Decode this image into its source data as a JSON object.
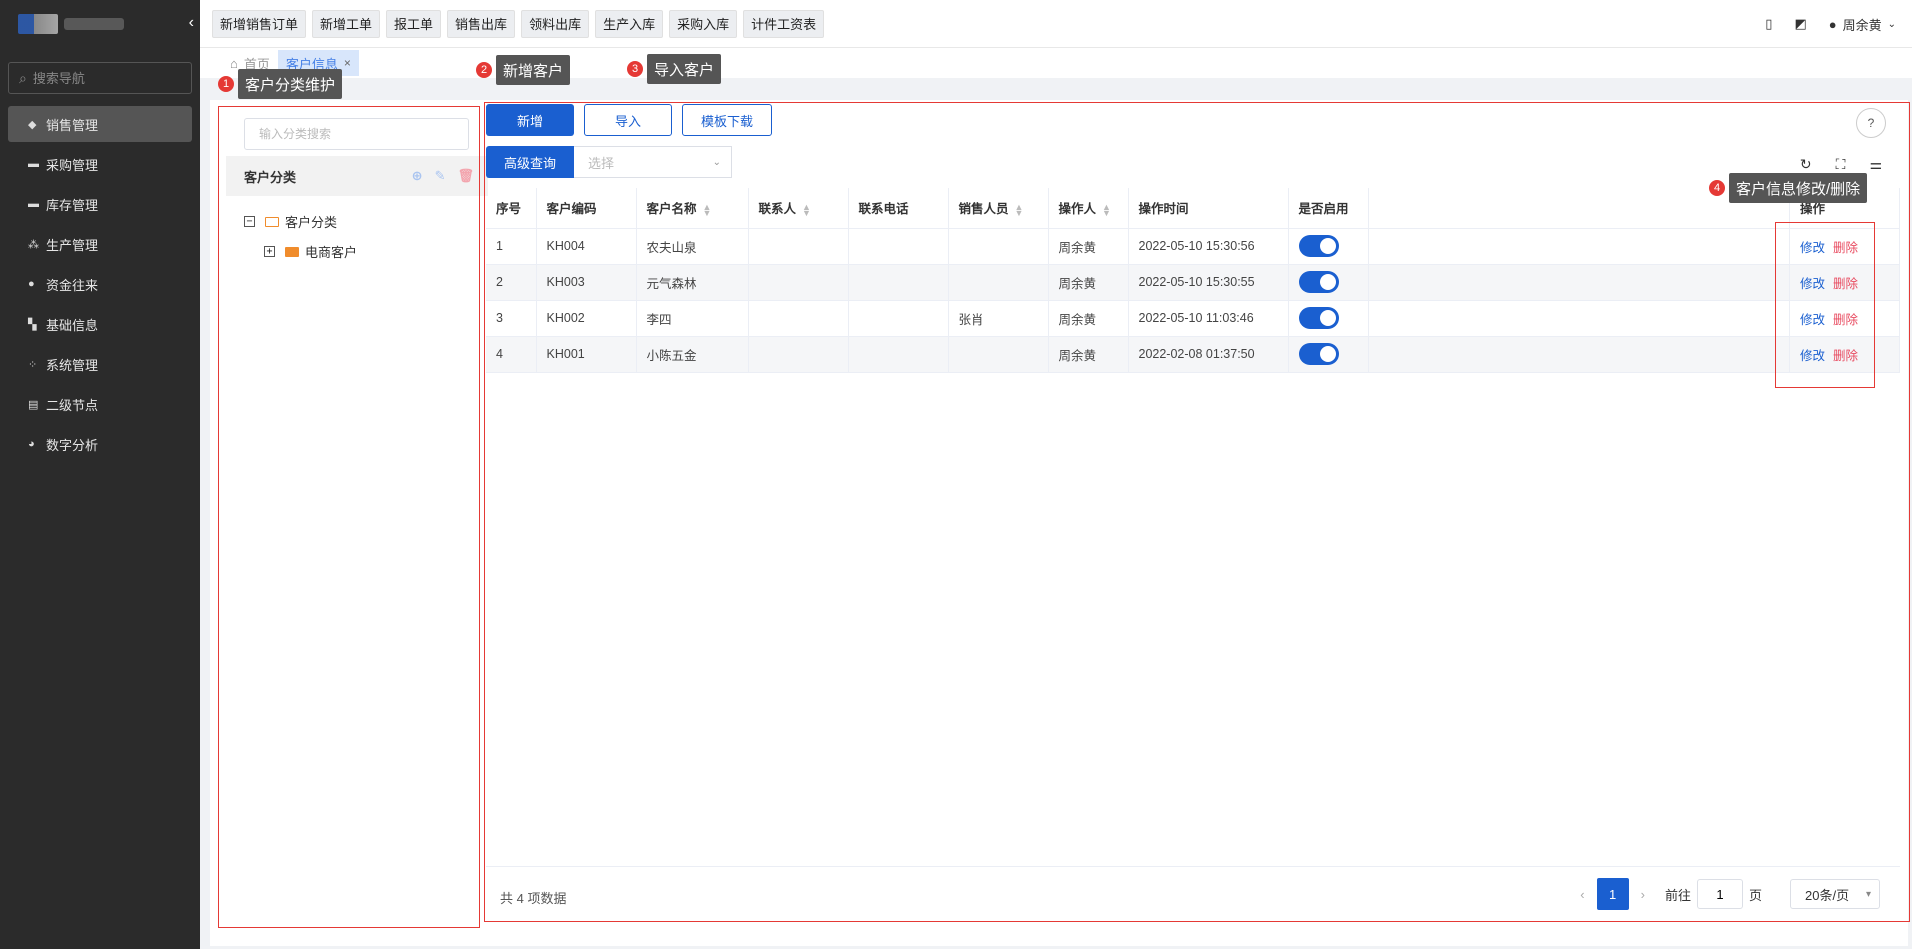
{
  "sidebar": {
    "search_placeholder": "搜索导航",
    "items": [
      {
        "label": "销售管理",
        "icon": "tag-icon",
        "glyph": "◆",
        "active": true
      },
      {
        "label": "采购管理",
        "icon": "cart-icon",
        "glyph": "▬",
        "active": false
      },
      {
        "label": "库存管理",
        "icon": "warehouse-icon",
        "glyph": "▬",
        "active": false
      },
      {
        "label": "生产管理",
        "icon": "production-icon",
        "glyph": "⁂",
        "active": false
      },
      {
        "label": "资金往来",
        "icon": "money-icon",
        "glyph": "●",
        "active": false
      },
      {
        "label": "基础信息",
        "icon": "info-icon",
        "glyph": "▚",
        "active": false
      },
      {
        "label": "系统管理",
        "icon": "system-icon",
        "glyph": "⁘",
        "active": false
      },
      {
        "label": "二级节点",
        "icon": "node-icon",
        "glyph": "▤",
        "active": false
      },
      {
        "label": "数字分析",
        "icon": "pie-chart-icon",
        "glyph": "◕",
        "active": false
      }
    ]
  },
  "topbar": {
    "quick_actions": [
      "新增销售订单",
      "新增工单",
      "报工单",
      "销售出库",
      "领料出库",
      "生产入库",
      "采购入库",
      "计件工资表"
    ],
    "user_name": "周余黄"
  },
  "tabs": {
    "home": "首页",
    "current": "客户信息",
    "close": "×"
  },
  "tree": {
    "search_placeholder": "输入分类搜索",
    "header": "客户分类",
    "root": "客户分类",
    "child": "电商客户"
  },
  "toolbar": {
    "add": "新增",
    "import": "导入",
    "template": "模板下载",
    "advanced": "高级查询",
    "select_placeholder": "选择"
  },
  "table": {
    "columns": [
      "序号",
      "客户编码",
      "客户名称",
      "联系人",
      "联系电话",
      "销售人员",
      "操作人",
      "操作时间",
      "是否启用",
      "",
      "操作"
    ],
    "rows": [
      {
        "no": "1",
        "code": "KH004",
        "name": "农夫山泉",
        "contact": "",
        "phone": "",
        "sales": "",
        "operator": "周余黄",
        "time": "2022-05-10 15:30:56",
        "enabled": true
      },
      {
        "no": "2",
        "code": "KH003",
        "name": "元气森林",
        "contact": "",
        "phone": "",
        "sales": "",
        "operator": "周余黄",
        "time": "2022-05-10 15:30:55",
        "enabled": true
      },
      {
        "no": "3",
        "code": "KH002",
        "name": "李四",
        "contact": "",
        "phone": "",
        "sales": "张肖",
        "operator": "周余黄",
        "time": "2022-05-10 11:03:46",
        "enabled": true
      },
      {
        "no": "4",
        "code": "KH001",
        "name": "小陈五金",
        "contact": "",
        "phone": "",
        "sales": "",
        "operator": "周余黄",
        "time": "2022-02-08 01:37:50",
        "enabled": true
      }
    ],
    "edit_label": "修改",
    "delete_label": "删除"
  },
  "pagination": {
    "total": "共 4 项数据",
    "current_page": "1",
    "goto_prefix": "前往",
    "goto_value": "1",
    "goto_suffix": "页",
    "page_size": "20条/页"
  },
  "annotations": [
    {
      "num": "1",
      "label": "客户分类维护"
    },
    {
      "num": "2",
      "label": "新增客户"
    },
    {
      "num": "3",
      "label": "导入客户"
    },
    {
      "num": "4",
      "label": "客户信息修改/删除"
    }
  ],
  "colors": {
    "primary": "#1a5fd0",
    "danger": "#e84a5f",
    "annotation_red": "#e53935",
    "sidebar_bg": "#2b2b2b"
  }
}
